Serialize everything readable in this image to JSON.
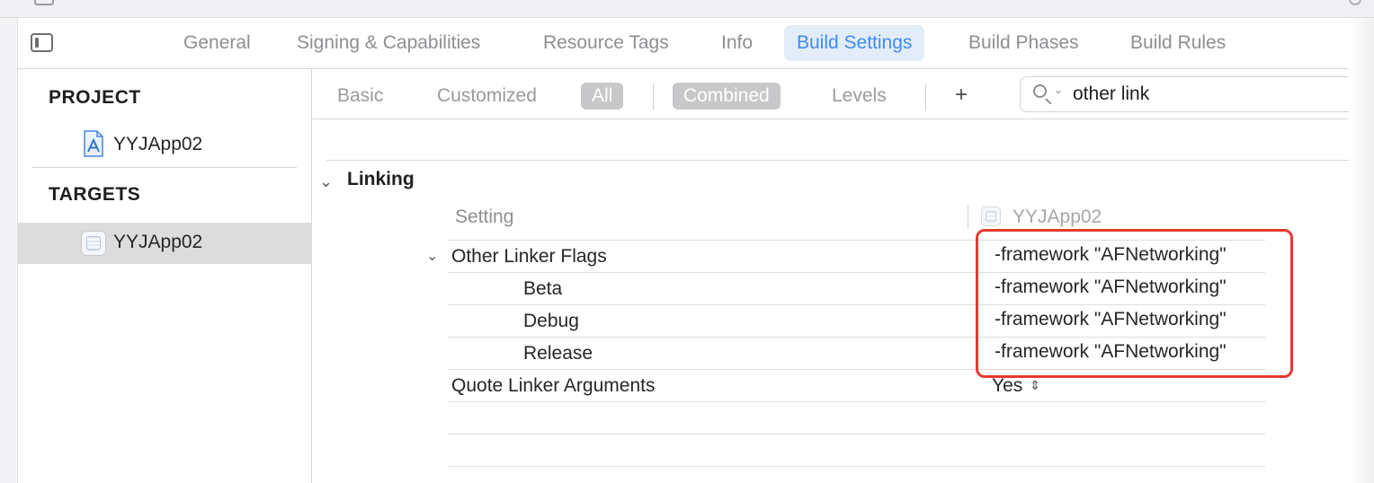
{
  "editor_tabs": [
    {
      "label": "General",
      "active": false
    },
    {
      "label": "Signing & Capabilities",
      "active": false
    },
    {
      "label": "Resource Tags",
      "active": false
    },
    {
      "label": "Info",
      "active": false
    },
    {
      "label": "Build Settings",
      "active": true
    },
    {
      "label": "Build Phases",
      "active": false
    },
    {
      "label": "Build Rules",
      "active": false
    }
  ],
  "sidebar": {
    "project_header": "PROJECT",
    "project_item": "YYJApp02",
    "targets_header": "TARGETS",
    "target_item": "YYJApp02"
  },
  "filter": {
    "basic": "Basic",
    "customized": "Customized",
    "all": "All",
    "combined": "Combined",
    "levels": "Levels",
    "add": "+",
    "search_value": "other link"
  },
  "section": {
    "title": "Linking",
    "column_setting": "Setting",
    "column_target": "YYJApp02"
  },
  "rows": [
    {
      "name": "Other Linker Flags",
      "value": "-framework \"AFNetworking\""
    },
    {
      "name": "Beta",
      "value": "-framework \"AFNetworking\""
    },
    {
      "name": "Debug",
      "value": "-framework \"AFNetworking\""
    },
    {
      "name": "Release",
      "value": "-framework \"AFNetworking\""
    },
    {
      "name": "Quote Linker Arguments",
      "value": "Yes"
    }
  ],
  "colors": {
    "accent": "#3e8cf5",
    "highlight": "#e23b2e"
  }
}
